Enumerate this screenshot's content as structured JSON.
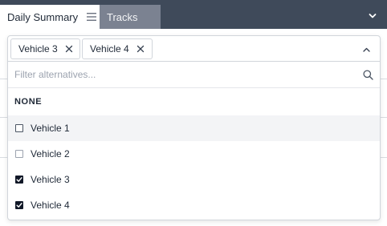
{
  "tabs": [
    {
      "label": "Daily Summary",
      "active": true,
      "icon": "menu-icon"
    },
    {
      "label": "Tracks",
      "active": false
    }
  ],
  "tabbar": {
    "chevron_icon": "chevron-down-icon"
  },
  "select": {
    "chips": [
      {
        "label": "Vehicle 3",
        "remove_icon": "close-icon"
      },
      {
        "label": "Vehicle 4",
        "remove_icon": "close-icon"
      }
    ],
    "toggle_icon": "chevron-up-icon"
  },
  "filter": {
    "placeholder": "Filter alternatives...",
    "value": "",
    "icon": "search-icon"
  },
  "none_option": {
    "label": "NONE"
  },
  "options": [
    {
      "label": "Vehicle 1",
      "checked": false
    },
    {
      "label": "Vehicle 2",
      "checked": false
    },
    {
      "label": "Vehicle 3",
      "checked": true
    },
    {
      "label": "Vehicle 4",
      "checked": true
    }
  ],
  "colors": {
    "tabbar_bg": "#3f4a5a",
    "inactive_tab_bg": "#7b8291",
    "checkbox_checked": "#111827"
  }
}
